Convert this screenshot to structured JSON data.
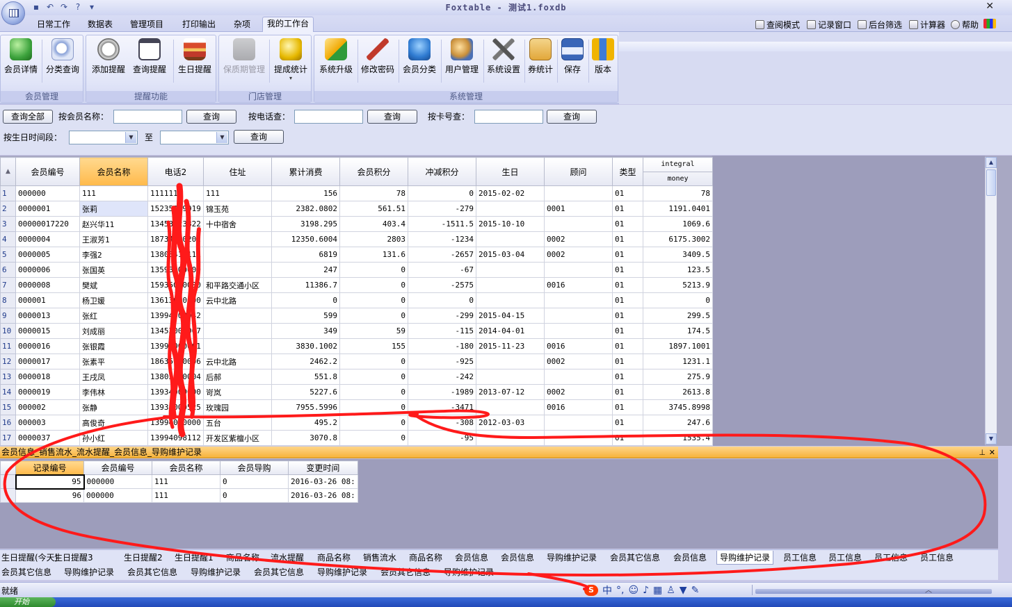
{
  "window": {
    "title": "Foxtable - 测试1.foxdb"
  },
  "menu_tabs": [
    "日常工作",
    "数据表",
    "管理项目",
    "打印输出",
    "杂项",
    "我的工作台"
  ],
  "active_menu_tab": "我的工作台",
  "right_tools": [
    "查阅模式",
    "记录窗口",
    "后台筛选",
    "计算器",
    "帮助"
  ],
  "ribbon_groups": [
    {
      "label": "会员管理",
      "buttons": [
        "会员详情",
        "分类查询"
      ]
    },
    {
      "label": "提醒功能",
      "buttons": [
        "添加提醒",
        "查询提醒",
        "生日提醒"
      ]
    },
    {
      "label": "门店管理",
      "buttons": [
        "保质期管理",
        "提成统计"
      ]
    },
    {
      "label": "系统管理",
      "buttons": [
        "系统升级",
        "修改密码",
        "会员分类",
        "用户管理",
        "系统设置",
        "券统计",
        "保存",
        "版本"
      ]
    }
  ],
  "query": {
    "all_button": "查询全部",
    "by_name_label": "按会员名称：",
    "by_phone_label": "按电话查：",
    "by_card_label": "按卡号查：",
    "query_button": "查询",
    "birthday_label": "按生日时间段：",
    "to_label": "至"
  },
  "main_table": {
    "columns": [
      "会员编号",
      "会员名称",
      "电话2",
      "住址",
      "累计消费",
      "会员积分",
      "冲减积分",
      "生日",
      "顾问",
      "类型"
    ],
    "last_column_top": "integral",
    "last_column_bottom": "money",
    "rows": [
      [
        "1",
        "000000",
        "111",
        "111111",
        "111",
        "156",
        "78",
        "0",
        "2015-02-02",
        "",
        "01",
        "78"
      ],
      [
        "2",
        "0000001",
        "张莉",
        "15235089919",
        "锦玉苑",
        "2382.0802",
        "561.51",
        "-279",
        "",
        "0001",
        "01",
        "1191.0401"
      ],
      [
        "3",
        "00000017220",
        "赵兴华11",
        "13453023822",
        "十中宿舍",
        "3198.295",
        "403.4",
        "-1511.5",
        "2015-10-10",
        "",
        "01",
        "1069.6"
      ],
      [
        "4",
        "0000004",
        "王淑芳1",
        "18734300202",
        "",
        "12350.6004",
        "2803",
        "-1234",
        "",
        "0002",
        "01",
        "6175.3002"
      ],
      [
        "5",
        "0000005",
        "李强2",
        "13803411111",
        "",
        "6819",
        "131.6",
        "-2657",
        "2015-03-04",
        "0002",
        "01",
        "3409.5"
      ],
      [
        "6",
        "0000006",
        "张国英",
        "13593000000",
        "",
        "247",
        "0",
        "-67",
        "",
        "",
        "01",
        "123.5"
      ],
      [
        "7",
        "0000008",
        "樊斌",
        "15935000000",
        "和平路交通小区",
        "11386.7",
        "0",
        "-2575",
        "",
        "0016",
        "01",
        "5213.9"
      ],
      [
        "8",
        "000001",
        "杨卫媛",
        "13613000000",
        "云中北路",
        "0",
        "0",
        "0",
        "",
        "",
        "01",
        "0"
      ],
      [
        "9",
        "0000013",
        "张红",
        "13994000042",
        "",
        "599",
        "0",
        "-299",
        "2015-04-15",
        "",
        "01",
        "299.5"
      ],
      [
        "10",
        "0000015",
        "刘成丽",
        "13453000007",
        "",
        "349",
        "59",
        "-115",
        "2014-04-01",
        "",
        "01",
        "174.5"
      ],
      [
        "11",
        "0000016",
        "张银霞",
        "13994000001",
        "",
        "3830.1002",
        "155",
        "-180",
        "2015-11-23",
        "0016",
        "01",
        "1897.1001"
      ],
      [
        "12",
        "0000017",
        "张素平",
        "18635000006",
        "云中北路",
        "2462.2",
        "0",
        "-925",
        "",
        "0002",
        "01",
        "1231.1"
      ],
      [
        "13",
        "0000018",
        "王戌凤",
        "13803000004",
        "后郝",
        "551.8",
        "0",
        "-242",
        "",
        "",
        "01",
        "275.9"
      ],
      [
        "14",
        "0000019",
        "李伟林",
        "13934000000",
        "岢岚",
        "5227.6",
        "0",
        "-1989",
        "2013-07-12",
        "0002",
        "01",
        "2613.8"
      ],
      [
        "15",
        "000002",
        "张静",
        "13935000525",
        "玫瑰园",
        "7955.5996",
        "0",
        "-3471",
        "",
        "0016",
        "01",
        "3745.8998"
      ],
      [
        "16",
        "000003",
        "高俊奇",
        "13994000000",
        "五台",
        "495.2",
        "0",
        "-308",
        "2012-03-03",
        "",
        "01",
        "247.6"
      ],
      [
        "17",
        "0000037",
        "孙小红",
        "13994098112",
        "开发区紫檀小区",
        "3070.8",
        "0",
        "-95",
        "",
        "",
        "01",
        "1535.4"
      ]
    ]
  },
  "panel_title": "会员信息_销售流水_流水提醒_会员信息_导购维护记录",
  "sub_table": {
    "columns": [
      "记录编号",
      "会员编号",
      "会员名称",
      "会员导购",
      "变更时间"
    ],
    "rows": [
      [
        "95",
        "000000",
        "111",
        "0",
        "2016-03-26 08:"
      ],
      [
        "96",
        "000000",
        "111",
        "0",
        "2016-03-26 08:"
      ]
    ]
  },
  "doc_tabs_row1": [
    "生日提醒(今天)",
    "生日提醒3",
    "生日提醒2",
    "生日提醒1",
    "商品名称",
    "流水提醒",
    "商品名称",
    "销售流水",
    "商品名称",
    "会员信息",
    "会员信息",
    "导购维护记录",
    "会员其它信息",
    "会员信息",
    "导购维护记录",
    "员工信息",
    "员工信息",
    "员工信息",
    "员工信息"
  ],
  "doc_tabs_row2": [
    "会员其它信息",
    "导购维护记录",
    "会员其它信息",
    "导购维护记录",
    "会员其它信息",
    "导购维护记录",
    "会员其它信息",
    "导购维护记录"
  ],
  "active_doc_tab_index": 14,
  "status": {
    "text": "就绪"
  },
  "ime": {
    "label": "中"
  },
  "taskbar": {
    "start_label": "开始"
  },
  "colors": {
    "annotation_red": "#ff1a1a",
    "header_selected": "#ffb94a",
    "ribbon_bg": "#dadff5"
  }
}
